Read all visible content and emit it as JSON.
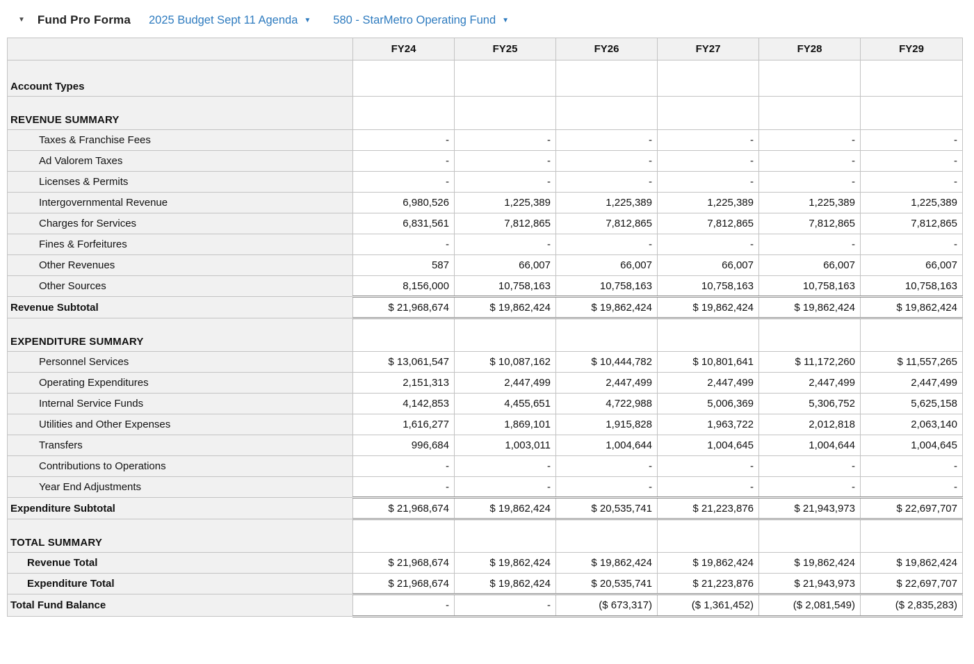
{
  "toolbar": {
    "collapse_icon": "caret-down",
    "title": "Fund Pro Forma",
    "budget_dropdown": {
      "label": "2025 Budget Sept 11 Agenda"
    },
    "fund_dropdown": {
      "label": "580 - StarMetro Operating Fund"
    }
  },
  "colors": {
    "link_blue": "#2e7bbf",
    "label_column_bg": "#f1f1f1",
    "grid_border": "#c3c3c3"
  },
  "table": {
    "columns": [
      "FY24",
      "FY25",
      "FY26",
      "FY27",
      "FY28",
      "FY29"
    ],
    "rows": [
      {
        "label": "Account Types",
        "type": "group",
        "values": [
          "",
          "",
          "",
          "",
          "",
          ""
        ]
      },
      {
        "label": "REVENUE SUMMARY",
        "type": "section",
        "values": [
          "",
          "",
          "",
          "",
          "",
          ""
        ]
      },
      {
        "label": "Taxes & Franchise Fees",
        "type": "item",
        "values": [
          "-",
          "-",
          "-",
          "-",
          "-",
          "-"
        ]
      },
      {
        "label": "Ad Valorem Taxes",
        "type": "item",
        "values": [
          "-",
          "-",
          "-",
          "-",
          "-",
          "-"
        ]
      },
      {
        "label": "Licenses & Permits",
        "type": "item",
        "values": [
          "-",
          "-",
          "-",
          "-",
          "-",
          "-"
        ]
      },
      {
        "label": "Intergovernmental Revenue",
        "type": "item",
        "values": [
          "6,980,526",
          "1,225,389",
          "1,225,389",
          "1,225,389",
          "1,225,389",
          "1,225,389"
        ]
      },
      {
        "label": "Charges for Services",
        "type": "item",
        "values": [
          "6,831,561",
          "7,812,865",
          "7,812,865",
          "7,812,865",
          "7,812,865",
          "7,812,865"
        ]
      },
      {
        "label": "Fines & Forfeitures",
        "type": "item",
        "values": [
          "-",
          "-",
          "-",
          "-",
          "-",
          "-"
        ]
      },
      {
        "label": "Other Revenues",
        "type": "item",
        "values": [
          "587",
          "66,007",
          "66,007",
          "66,007",
          "66,007",
          "66,007"
        ]
      },
      {
        "label": "Other Sources",
        "type": "item",
        "values": [
          "8,156,000",
          "10,758,163",
          "10,758,163",
          "10,758,163",
          "10,758,163",
          "10,758,163"
        ]
      },
      {
        "label": "Revenue Subtotal",
        "type": "subtotal",
        "values": [
          "$ 21,968,674",
          "$ 19,862,424",
          "$ 19,862,424",
          "$ 19,862,424",
          "$ 19,862,424",
          "$ 19,862,424"
        ]
      },
      {
        "label": "EXPENDITURE SUMMARY",
        "type": "section",
        "values": [
          "",
          "",
          "",
          "",
          "",
          ""
        ]
      },
      {
        "label": "Personnel Services",
        "type": "item",
        "values": [
          "$ 13,061,547",
          "$ 10,087,162",
          "$ 10,444,782",
          "$ 10,801,641",
          "$ 11,172,260",
          "$ 11,557,265"
        ]
      },
      {
        "label": "Operating Expenditures",
        "type": "item",
        "values": [
          "2,151,313",
          "2,447,499",
          "2,447,499",
          "2,447,499",
          "2,447,499",
          "2,447,499"
        ]
      },
      {
        "label": "Internal Service Funds",
        "type": "item",
        "values": [
          "4,142,853",
          "4,455,651",
          "4,722,988",
          "5,006,369",
          "5,306,752",
          "5,625,158"
        ]
      },
      {
        "label": "Utilities and Other Expenses",
        "type": "item",
        "values": [
          "1,616,277",
          "1,869,101",
          "1,915,828",
          "1,963,722",
          "2,012,818",
          "2,063,140"
        ]
      },
      {
        "label": "Transfers",
        "type": "item",
        "values": [
          "996,684",
          "1,003,011",
          "1,004,644",
          "1,004,645",
          "1,004,644",
          "1,004,645"
        ]
      },
      {
        "label": "Contributions to Operations",
        "type": "item",
        "values": [
          "-",
          "-",
          "-",
          "-",
          "-",
          "-"
        ]
      },
      {
        "label": "Year End Adjustments",
        "type": "item",
        "values": [
          "-",
          "-",
          "-",
          "-",
          "-",
          "-"
        ]
      },
      {
        "label": "Expenditure Subtotal",
        "type": "subtotal",
        "values": [
          "$ 21,968,674",
          "$ 19,862,424",
          "$ 20,535,741",
          "$ 21,223,876",
          "$ 21,943,973",
          "$ 22,697,707"
        ]
      },
      {
        "label": "TOTAL SUMMARY",
        "type": "section",
        "values": [
          "",
          "",
          "",
          "",
          "",
          ""
        ]
      },
      {
        "label": "Revenue Total",
        "type": "total-item",
        "values": [
          "$ 21,968,674",
          "$ 19,862,424",
          "$ 19,862,424",
          "$ 19,862,424",
          "$ 19,862,424",
          "$ 19,862,424"
        ]
      },
      {
        "label": "Expenditure Total",
        "type": "total-item",
        "values": [
          "$ 21,968,674",
          "$ 19,862,424",
          "$ 20,535,741",
          "$ 21,223,876",
          "$ 21,943,973",
          "$ 22,697,707"
        ]
      },
      {
        "label": "Total Fund Balance",
        "type": "grand",
        "values": [
          "-",
          "-",
          "($ 673,317)",
          "($ 1,361,452)",
          "($ 2,081,549)",
          "($ 2,835,283)"
        ]
      }
    ]
  }
}
